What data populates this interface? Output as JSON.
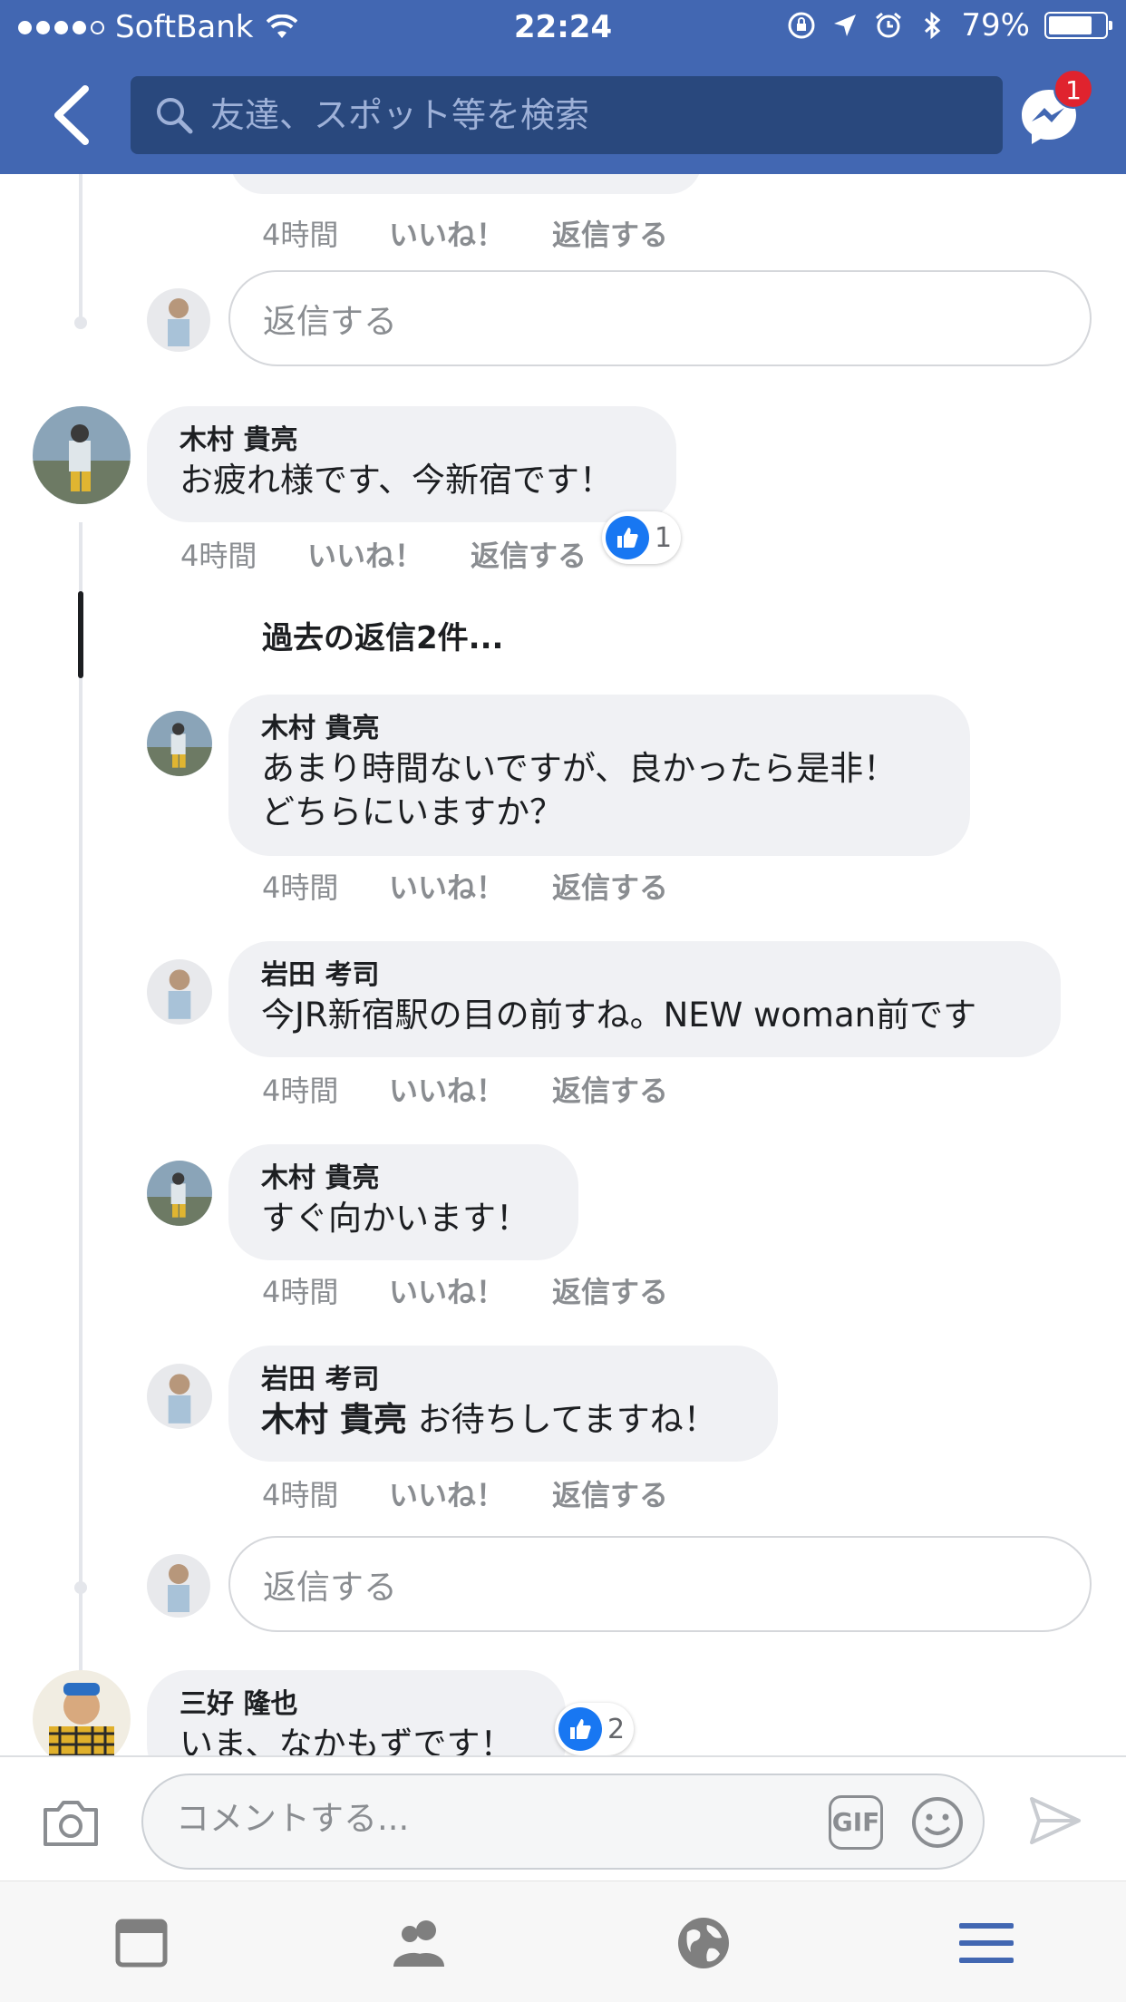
{
  "status_bar": {
    "carrier": "SoftBank",
    "time": "22:24",
    "battery": "79%",
    "battery_level": 0.79
  },
  "header": {
    "search_placeholder": "友達、スポット等を検索",
    "messenger_badge": "1"
  },
  "thread_top": {
    "meta": {
      "time": "4時間",
      "like": "いいね！",
      "reply": "返信する"
    },
    "reply_placeholder": "返信する"
  },
  "comment_kimura": {
    "name": "木村 貴亮",
    "text": "お疲れ様です、今新宿です！",
    "meta": {
      "time": "4時間",
      "like": "いいね！",
      "reply": "返信する"
    },
    "reactions": "1"
  },
  "previous_replies": "過去の返信2件...",
  "replies": [
    {
      "name": "木村 貴亮",
      "lines": [
        "あまり時間ないですが、良かったら是非！",
        "どちらにいますか？"
      ],
      "meta": {
        "time": "4時間",
        "like": "いいね！",
        "reply": "返信する"
      }
    },
    {
      "name": "岩田 考司",
      "lines": [
        "今JR新宿駅の目の前すね。NEW woman前です"
      ],
      "meta": {
        "time": "4時間",
        "like": "いいね！",
        "reply": "返信する"
      }
    },
    {
      "name": "木村 貴亮",
      "lines": [
        "すぐ向かいます！"
      ],
      "meta": {
        "time": "4時間",
        "like": "いいね！",
        "reply": "返信する"
      }
    },
    {
      "name": "岩田 考司",
      "mention": "木村 貴亮",
      "text": "お待ちしてますね！",
      "meta": {
        "time": "4時間",
        "like": "いいね！",
        "reply": "返信する"
      }
    }
  ],
  "thread_reply_placeholder": "返信する",
  "comment_miyoshi": {
    "name": "三好 隆也",
    "text": "いま、なかもずです！",
    "reactions": "2"
  },
  "composer": {
    "placeholder": "コメントする...",
    "gif_label": "GIF"
  },
  "colors": {
    "header_bg": "#4267b2",
    "search_bg": "#29487d",
    "bubble_bg": "#f0f1f4",
    "like_blue": "#1877f2",
    "tab_active": "#4267b2"
  },
  "tabs": [
    "news-feed-icon",
    "friends-icon",
    "globe-icon",
    "menu-icon"
  ]
}
